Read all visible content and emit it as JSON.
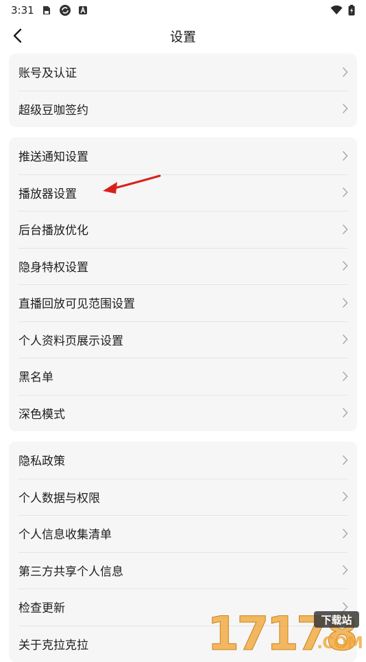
{
  "status_bar": {
    "time": "3:31"
  },
  "header": {
    "title": "设置"
  },
  "groups": [
    {
      "items": [
        "账号及认证",
        "超级豆咖签约"
      ]
    },
    {
      "items": [
        "推送通知设置",
        "播放器设置",
        "后台播放优化",
        "隐身特权设置",
        "直播回放可见范围设置",
        "个人资料页展示设置",
        "黑名单",
        "深色模式"
      ]
    },
    {
      "items": [
        "隐私政策",
        "个人数据与权限",
        "个人信息收集清单",
        "第三方共享个人信息",
        "检查更新",
        "关于克拉克拉"
      ]
    }
  ],
  "watermark": {
    "number": "17178",
    "badge": "下载站",
    "suffix": ".COM"
  },
  "colors": {
    "group_bg": "#f6f6f6",
    "divider": "#e4e4e4",
    "annotation": "#d9201a",
    "watermark_orange": "#f0a22e",
    "watermark_dark": "#3a3a3a"
  }
}
